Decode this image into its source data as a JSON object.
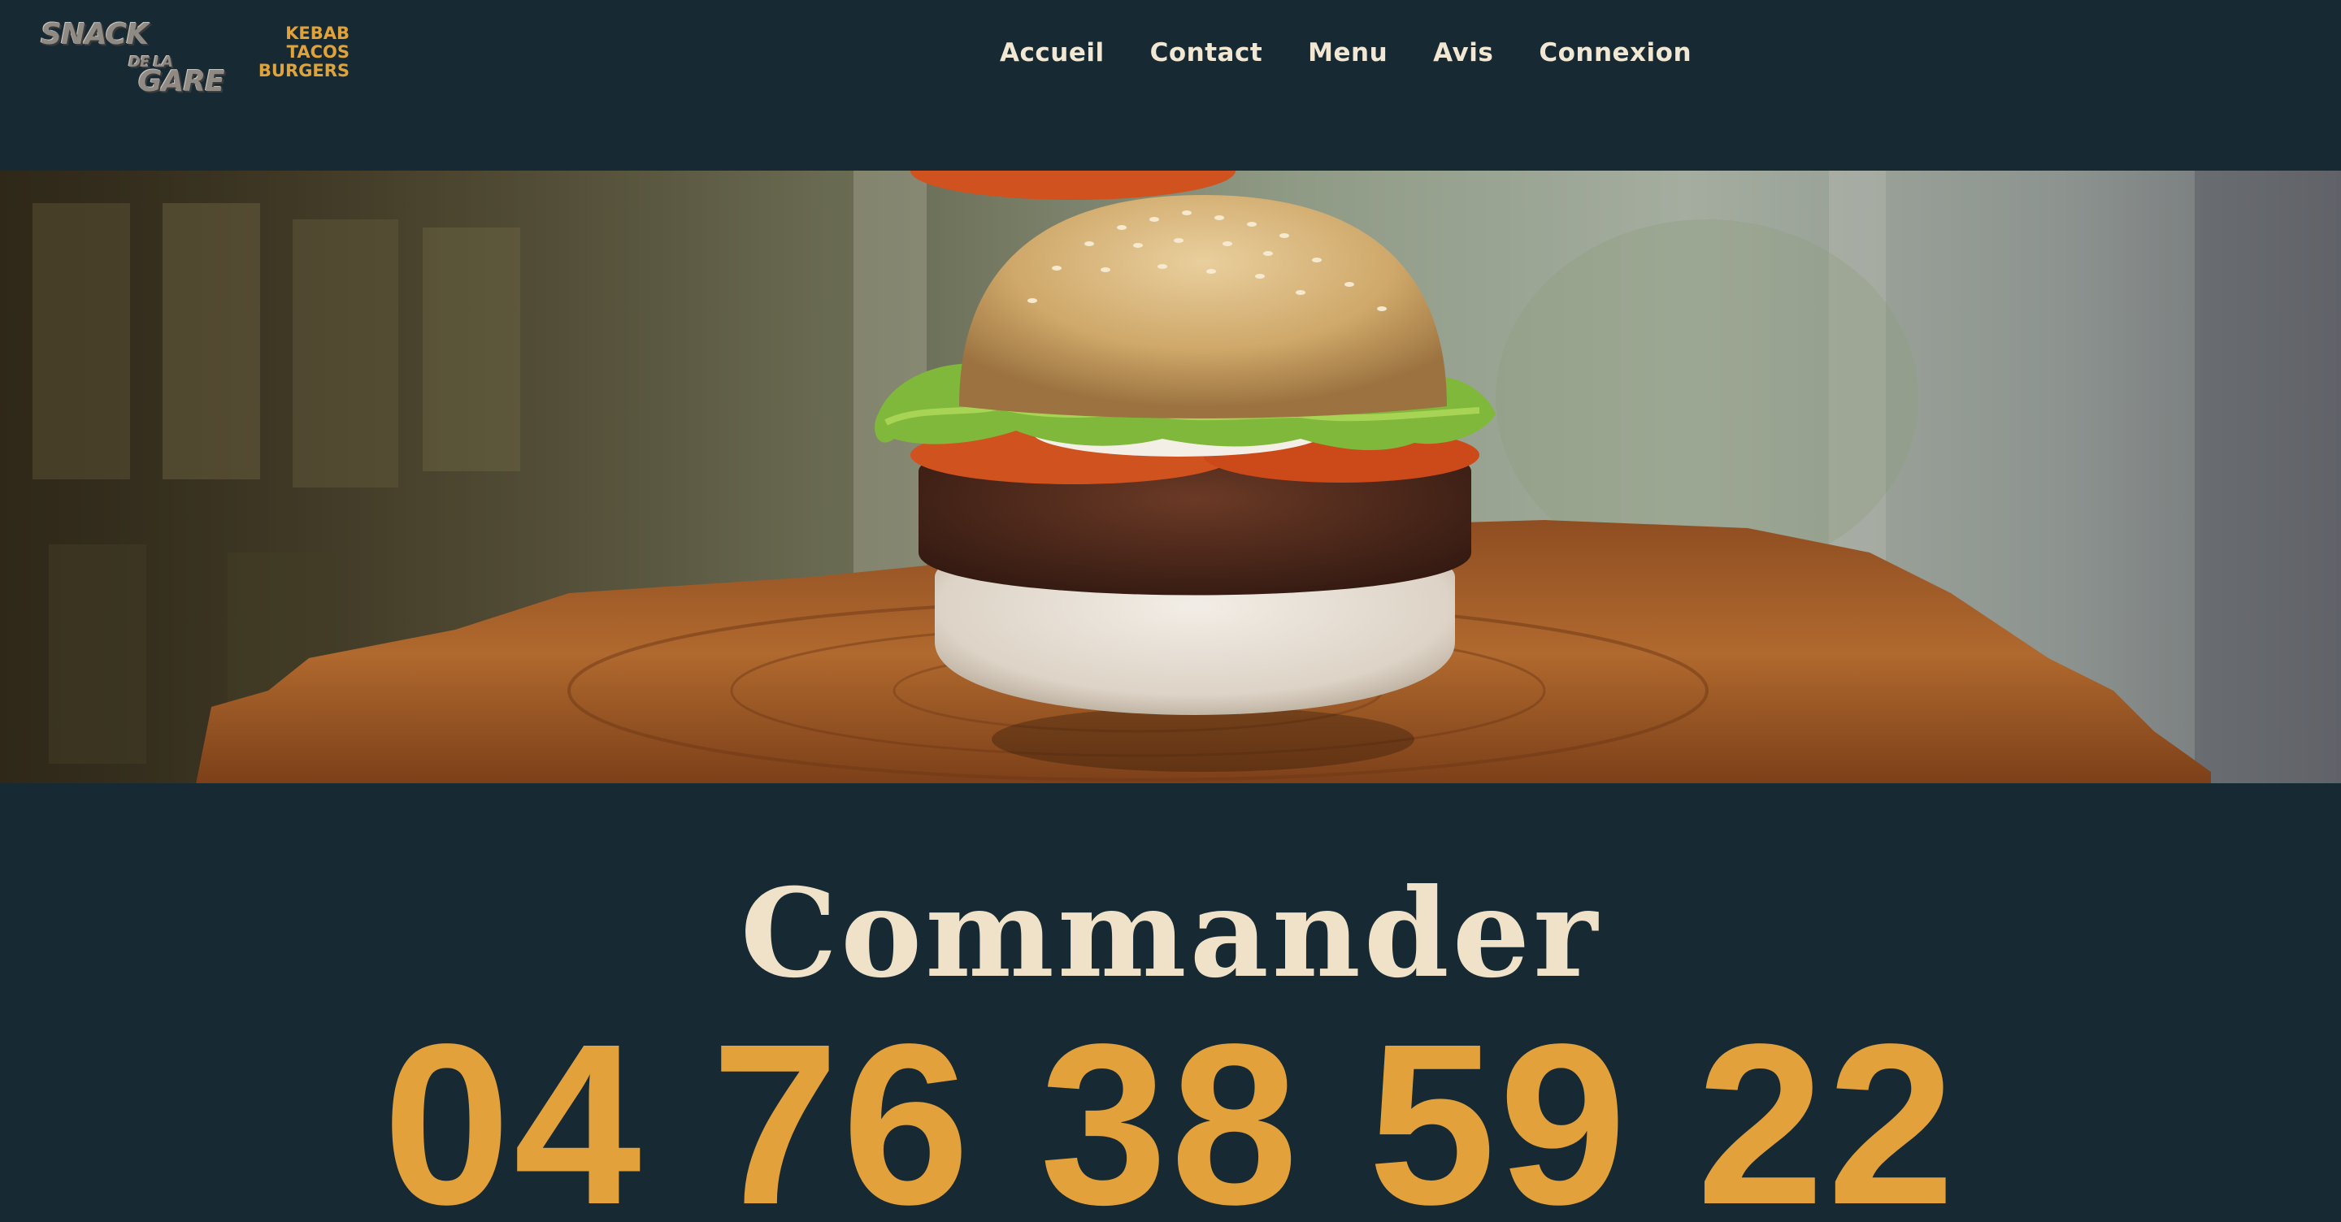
{
  "header": {
    "logo": {
      "word1": "SNACK",
      "word2": "DE LA",
      "word3": "GARE",
      "tagline": [
        "KEBAB",
        "TACOS",
        "BURGERS"
      ]
    },
    "nav": [
      "Accueil",
      "Contact",
      "Menu",
      "Avis",
      "Connexion"
    ]
  },
  "hero": {
    "image": "burger-on-wood-board"
  },
  "order": {
    "title": "Commander",
    "phone": "04 76 38 59 22"
  },
  "colors": {
    "background": "#172a34",
    "accent": "#e2a13a",
    "nav_text": "#f1e7d2",
    "title_text": "#efe2c9"
  }
}
